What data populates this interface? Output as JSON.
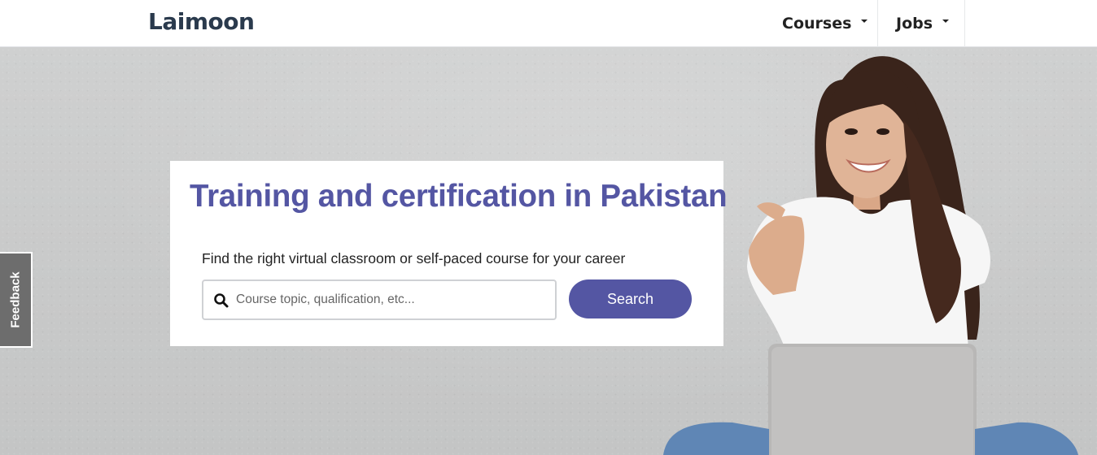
{
  "header": {
    "logo": "Laimoon",
    "nav": [
      {
        "label": "Courses"
      },
      {
        "label": "Jobs"
      }
    ]
  },
  "hero": {
    "headline": "Training and certification in Pakistan",
    "tagline": "Find the right virtual classroom or self-paced course for your career",
    "search": {
      "placeholder": "Course topic, qualification, etc...",
      "value": "",
      "button_label": "Search"
    }
  },
  "feedback_tab": {
    "label": "Feedback"
  },
  "colors": {
    "brand": "#5456a3",
    "logo": "#2a3a4d",
    "feedback_bg": "#6d6d6d"
  },
  "icons": [
    "search-icon",
    "chevron-down-icon"
  ]
}
